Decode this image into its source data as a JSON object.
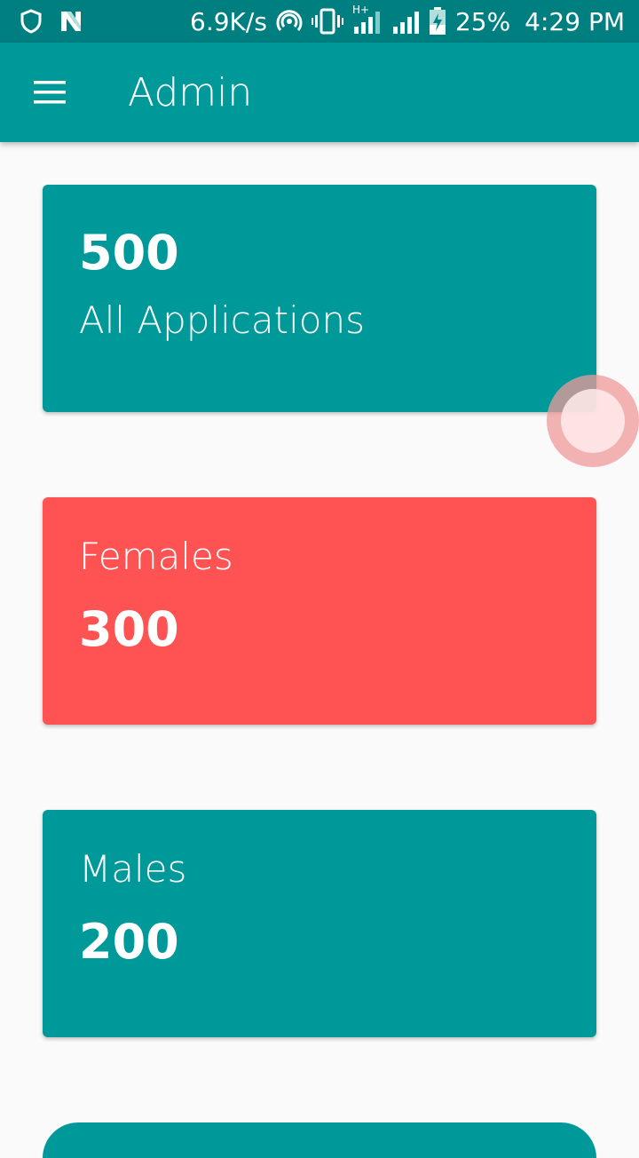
{
  "status_bar": {
    "network_speed": "6.9K/s",
    "network_type": "H+",
    "battery": "25%",
    "time": "4:29 PM",
    "icons": [
      "shield-icon",
      "n-notification-icon",
      "hotspot-icon",
      "vibrate-icon",
      "signal-icon",
      "signal-icon-2",
      "battery-charging-icon"
    ]
  },
  "app_bar": {
    "title": "Admin",
    "menu_icon": "hamburger-menu-icon",
    "color": "#009999"
  },
  "cards": [
    {
      "id": "all",
      "value": "500",
      "label": "All Applications",
      "color": "#009999"
    },
    {
      "id": "females",
      "value": "300",
      "label": "Females",
      "color": "#ff5252"
    },
    {
      "id": "males",
      "value": "200",
      "label": "Males",
      "color": "#009999"
    }
  ],
  "colors": {
    "status_bar": "#007f80",
    "accent": "#009999",
    "red": "#ff5252",
    "background": "#fafafa"
  }
}
